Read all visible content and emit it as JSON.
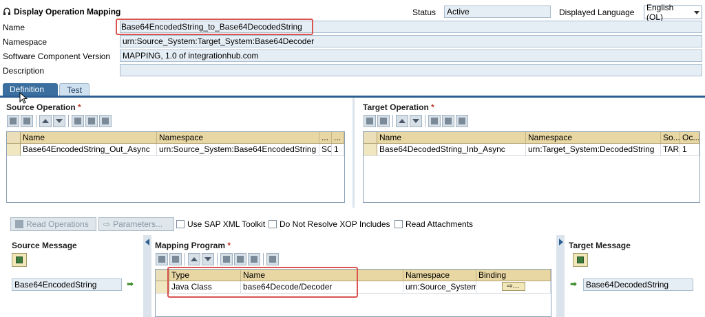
{
  "header": {
    "title": "Display Operation Mapping",
    "status_label": "Status",
    "status_value": "Active",
    "language_label": "Displayed Language",
    "language_value": "English (OL)"
  },
  "fields": {
    "name_label": "Name",
    "name_value": "Base64EncodedString_to_Base64DecodedString",
    "namespace_label": "Namespace",
    "namespace_value": "urn:Source_System:Target_System:Base64Decoder",
    "swcv_label": "Software Component Version",
    "swcv_value": "MAPPING, 1.0 of integrationhub.com",
    "description_label": "Description",
    "description_value": ""
  },
  "tabs": [
    {
      "label": "Definition",
      "active": true
    },
    {
      "label": "Test",
      "active": false
    }
  ],
  "source_operation": {
    "title": "Source Operation",
    "required": "*",
    "columns": [
      "Name",
      "Namespace",
      "...",
      "..."
    ],
    "rows": [
      [
        "Base64EncodedString_Out_Async",
        "urn:Source_System:Base64EncodedString",
        "SO",
        "1"
      ]
    ]
  },
  "target_operation": {
    "title": "Target Operation",
    "required": "*",
    "columns": [
      "Name",
      "Namespace",
      "So...",
      "Oc..."
    ],
    "rows": [
      [
        "Base64DecodedString_Inb_Async",
        "urn:Target_System:DecodedString",
        "TAR",
        "1"
      ]
    ]
  },
  "actions": {
    "read_operations": "Read Operations",
    "parameters": "Parameters...",
    "use_sap_xml": "Use SAP XML Toolkit",
    "do_not_resolve": "Do Not Resolve XOP Includes",
    "read_attachments": "Read Attachments"
  },
  "source_message": {
    "title": "Source Message",
    "value": "Base64EncodedString"
  },
  "mapping_program": {
    "title": "Mapping Program",
    "required": "*",
    "columns": [
      "Type",
      "Name",
      "Namespace",
      "Binding"
    ],
    "rows": [
      [
        "Java Class",
        "base64Decode/Decoder",
        "urn:Source_System",
        ""
      ]
    ]
  },
  "target_message": {
    "title": "Target Message",
    "value": "Base64DecodedString"
  },
  "colors": {
    "tab_active": "#3a6f9f",
    "grid_header": "#e8d7a3",
    "highlight": "#d9534f",
    "field_bg": "#e6eef5"
  }
}
